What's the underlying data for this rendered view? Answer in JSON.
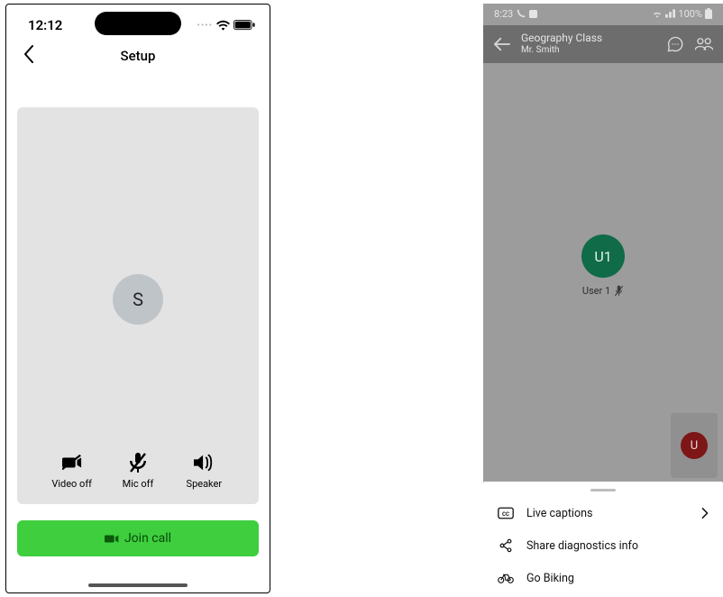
{
  "left": {
    "status": {
      "time": "12:12"
    },
    "nav": {
      "title": "Setup"
    },
    "avatar_initial": "S",
    "controls": {
      "video_label": "Video off",
      "mic_label": "Mic off",
      "speaker_label": "Speaker"
    },
    "join_button_label": "Join call"
  },
  "right": {
    "status": {
      "time": "8:23",
      "battery_text": "100%"
    },
    "header": {
      "title": "Geography Class",
      "subtitle": "Mr. Smith"
    },
    "participant": {
      "avatar_text": "U1",
      "name": "User 1"
    },
    "pip_avatar_text": "U",
    "sheet": {
      "items": [
        {
          "label": "Live captions",
          "has_chevron": true
        },
        {
          "label": "Share diagnostics info",
          "has_chevron": false
        },
        {
          "label": "Go Biking",
          "has_chevron": false
        }
      ]
    }
  }
}
